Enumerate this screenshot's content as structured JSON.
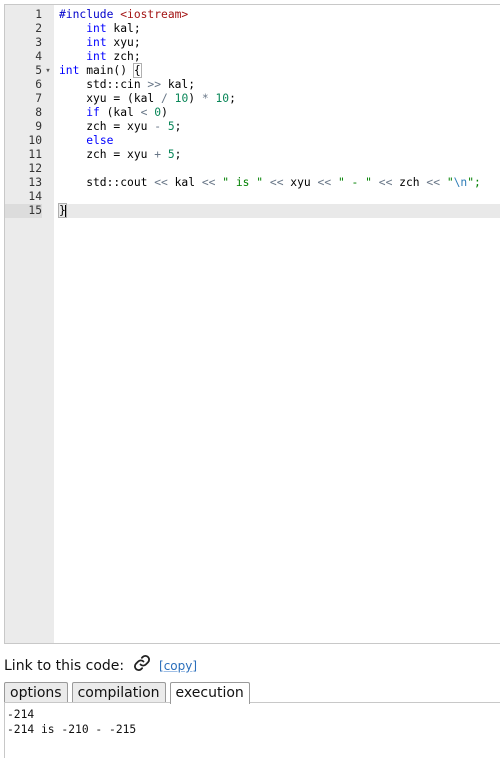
{
  "editor": {
    "fold_marker": "▾",
    "lines": [
      {
        "n": "1",
        "tokens": [
          {
            "t": "#include ",
            "c": "pp"
          },
          {
            "t": "<iostream>",
            "c": "hdr"
          }
        ]
      },
      {
        "n": "2",
        "tokens": [
          {
            "t": "    "
          },
          {
            "t": "int",
            "c": "kw"
          },
          {
            "t": " kal;"
          }
        ]
      },
      {
        "n": "3",
        "tokens": [
          {
            "t": "    "
          },
          {
            "t": "int",
            "c": "kw"
          },
          {
            "t": " xyu;"
          }
        ]
      },
      {
        "n": "4",
        "tokens": [
          {
            "t": "    "
          },
          {
            "t": "int",
            "c": "kw"
          },
          {
            "t": " zch;"
          }
        ]
      },
      {
        "n": "5",
        "fold": true,
        "tokens": [
          {
            "t": "int",
            "c": "kw"
          },
          {
            "t": " main() "
          },
          {
            "t": "{",
            "c": "br"
          }
        ]
      },
      {
        "n": "6",
        "tokens": [
          {
            "t": "    std::cin "
          },
          {
            "t": ">>",
            "c": "op"
          },
          {
            "t": " kal;"
          }
        ]
      },
      {
        "n": "7",
        "tokens": [
          {
            "t": "    xyu = (kal "
          },
          {
            "t": "/",
            "c": "op"
          },
          {
            "t": " "
          },
          {
            "t": "10",
            "c": "num"
          },
          {
            "t": ") "
          },
          {
            "t": "*",
            "c": "op"
          },
          {
            "t": " "
          },
          {
            "t": "10",
            "c": "num"
          },
          {
            "t": ";"
          }
        ]
      },
      {
        "n": "8",
        "tokens": [
          {
            "t": "    "
          },
          {
            "t": "if",
            "c": "kw"
          },
          {
            "t": " (kal "
          },
          {
            "t": "<",
            "c": "op"
          },
          {
            "t": " "
          },
          {
            "t": "0",
            "c": "num"
          },
          {
            "t": ")"
          }
        ]
      },
      {
        "n": "9",
        "tokens": [
          {
            "t": "    zch = xyu "
          },
          {
            "t": "-",
            "c": "op"
          },
          {
            "t": " "
          },
          {
            "t": "5",
            "c": "num"
          },
          {
            "t": ";"
          }
        ]
      },
      {
        "n": "10",
        "tokens": [
          {
            "t": "    "
          },
          {
            "t": "else",
            "c": "kw"
          }
        ]
      },
      {
        "n": "11",
        "tokens": [
          {
            "t": "    zch = xyu "
          },
          {
            "t": "+",
            "c": "op"
          },
          {
            "t": " "
          },
          {
            "t": "5",
            "c": "num"
          },
          {
            "t": ";"
          }
        ]
      },
      {
        "n": "12",
        "tokens": []
      },
      {
        "n": "13",
        "tokens": [
          {
            "t": "    std::cout "
          },
          {
            "t": "<<",
            "c": "op"
          },
          {
            "t": " kal "
          },
          {
            "t": "<<",
            "c": "op"
          },
          {
            "t": " "
          },
          {
            "t": "\" is \"",
            "c": "str"
          },
          {
            "t": " "
          },
          {
            "t": "<<",
            "c": "op"
          },
          {
            "t": " xyu "
          },
          {
            "t": "<<",
            "c": "op"
          },
          {
            "t": " "
          },
          {
            "t": "\" - \"",
            "c": "str"
          },
          {
            "t": " "
          },
          {
            "t": "<<",
            "c": "op"
          },
          {
            "t": " zch "
          },
          {
            "t": "<<",
            "c": "op"
          },
          {
            "t": " "
          },
          {
            "t": "\"",
            "c": "str"
          },
          {
            "t": "\\n",
            "c": "esc"
          },
          {
            "t": "\";",
            "c": "str"
          }
        ]
      },
      {
        "n": "14",
        "tokens": []
      },
      {
        "n": "15",
        "active": true,
        "caret": true,
        "tokens": [
          {
            "t": "}",
            "c": "br"
          }
        ]
      }
    ]
  },
  "link": {
    "label": "Link to this code:",
    "icon": "link-icon",
    "copy_label": "[copy]"
  },
  "tabs": [
    {
      "label": "options",
      "active": false
    },
    {
      "label": "compilation",
      "active": false
    },
    {
      "label": "execution",
      "active": true
    }
  ],
  "output": {
    "lines": [
      "-214",
      "-214 is -210 - -215"
    ]
  }
}
